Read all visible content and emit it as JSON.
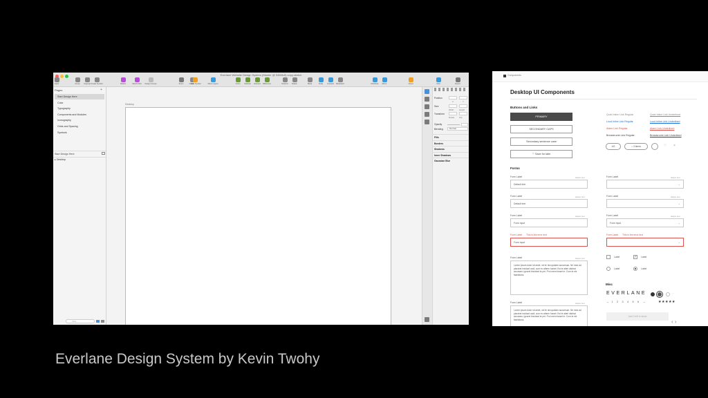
{
  "caption": "Everlane Design System by Kevin Twohy",
  "sketch": {
    "window_title": "Everlane Website Design System (Master @ 5456fc5) copy.sketch",
    "toolbar": [
      {
        "label": "Insert",
        "icon": "plus-icon"
      },
      {
        "label": "Group",
        "icon": "group-icon"
      },
      {
        "label": "Ungroup",
        "icon": "ungroup-icon"
      },
      {
        "label": "Create Symbol",
        "icon": "symbol-icon"
      },
      {
        "label": "Reflect",
        "icon": "reflect-icon"
      },
      {
        "label": "Sketch Part",
        "icon": "part-icon"
      },
      {
        "label": "Design Comps",
        "icon": "comps-icon"
      },
      {
        "label": "Zoom",
        "icon": "zoom-icon"
      },
      {
        "label": "Edit",
        "icon": "edit-icon"
      },
      {
        "label": "Create Symbol",
        "icon": "create-symbol-icon"
      },
      {
        "label": "Move Layout",
        "icon": "layout-icon"
      },
      {
        "label": "Union",
        "icon": "union-icon"
      },
      {
        "label": "Subtract",
        "icon": "subtract-icon"
      },
      {
        "label": "Intersect",
        "icon": "intersect-icon"
      },
      {
        "label": "Difference",
        "icon": "difference-icon"
      },
      {
        "label": "Scissors",
        "icon": "scissors-icon"
      },
      {
        "label": "Flatten",
        "icon": "flatten-icon"
      },
      {
        "label": "Mask",
        "icon": "mask-icon"
      },
      {
        "label": "Scale",
        "icon": "scale-icon"
      },
      {
        "label": "Forward",
        "icon": "forward-icon"
      },
      {
        "label": "Backward",
        "icon": "backward-icon"
      },
      {
        "label": "Distribute",
        "icon": "distribute-icon"
      },
      {
        "label": "Mirror",
        "icon": "mirror-icon"
      },
      {
        "label": "Cloud",
        "icon": "cloud-icon"
      },
      {
        "label": "View",
        "icon": "view-icon"
      },
      {
        "label": "Export",
        "icon": "export-icon"
      }
    ],
    "pages": {
      "header": "Pages",
      "items": [
        {
          "label": "Start Design Here",
          "selected": true
        },
        {
          "label": "Color",
          "selected": false
        },
        {
          "label": "Typography",
          "selected": false
        },
        {
          "label": "Components and Modules",
          "selected": false
        },
        {
          "label": "Iconography",
          "selected": false
        },
        {
          "label": "Grids and Spacing",
          "selected": false
        },
        {
          "label": "Symbols",
          "selected": false
        }
      ]
    },
    "layers": {
      "header": "Start Design Here",
      "items": [
        "Desktop"
      ]
    },
    "search_placeholder": "Filter",
    "artboard_label": "Desktop",
    "inspector": {
      "position_label": "Position",
      "x_label": "X",
      "y_label": "Y",
      "size_label": "Size",
      "width_label": "Width",
      "height_label": "Height",
      "transform_label": "Transform",
      "rotate_label": "Rotate",
      "flip_label": "Flip",
      "opacity_label": "Opacity",
      "blending_label": "Blending",
      "blending_value": "Normal",
      "sections": [
        "Fills",
        "Borders",
        "Shadows",
        "Inner Shadows",
        "Gaussian Blur"
      ]
    }
  },
  "doc": {
    "breadcrumb": "Components",
    "title": "Desktop UI Components",
    "buttons_header": "Buttons and Links",
    "buttons": [
      "PRIMARY",
      "SECONDARY CAPS",
      "Secondary sentence case",
      "Save for later"
    ],
    "links_left": [
      "Quiet Inline Link Regular",
      "Loud Inline Link Regular",
      "Alarm Link Regular",
      "Breadcrumb Link Regular"
    ],
    "links_right": [
      "Quiet Inline Link Underlined",
      "Loud Inline Link Underlined",
      "Alarm Link Underlined",
      "Breadcrumb Link Underlined"
    ],
    "pills": [
      "US",
      "3 items"
    ],
    "forms_header": "Forms",
    "form_label": "Form Label",
    "helper_text": "Helper text",
    "default_text": "Default text",
    "form_input": "Form input",
    "error_text": "This is the error text",
    "checkbox_label": "Label",
    "lorem": "Lorem ipsum dolor sit amet, vel te nisi quidam accumsan. Ne mea ad placerat incidunt audi, cum eu alterm fusset. Est te alteri distinct accusam, ignoret tincidunt te per. Pro lorem fusset in. Cum te ele fastidiutus.",
    "misc_header": "Misc",
    "logo": "EVERLANE",
    "pagination": [
      "←",
      "1",
      "2",
      "3",
      "4",
      "5",
      "6",
      "→"
    ],
    "stars": "★★★★★",
    "cta": "Add 2 left in stock",
    "colors": {
      "brand_dark": "#333333",
      "link_blue": "#1a6ed8",
      "alarm_red": "#d9534f",
      "sketch_accent": "#b64fd8"
    }
  }
}
